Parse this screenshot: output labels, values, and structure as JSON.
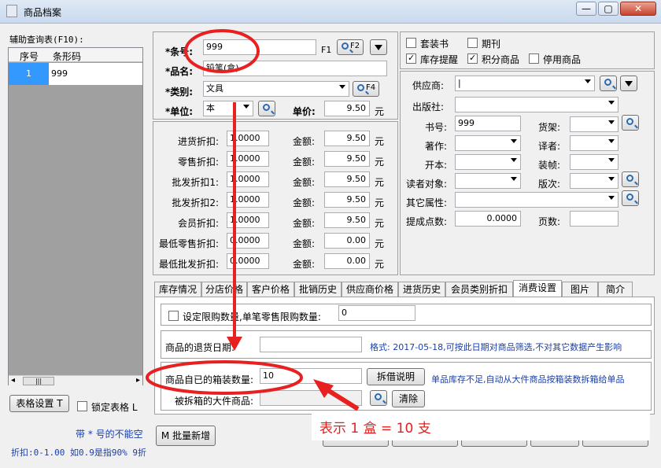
{
  "window": {
    "title": "商品档案",
    "minimize": "—",
    "maximize": "▢",
    "close": "✕"
  },
  "side": {
    "label": "辅助查询表(F10):",
    "columns": [
      "序号",
      "条形码"
    ],
    "rows": [
      {
        "no": "1",
        "code": "999"
      }
    ],
    "scroll_thumb": "|||",
    "grid_settings_btn": "表格设置 T",
    "lock_grid_label": "锁定表格 L",
    "required_note": "带 * 号的不能空",
    "discount_note": "折扣:0-1.00 如0.9是指90%  9折",
    "batch_add_btn": "M 批量新增"
  },
  "basic": {
    "barcode_label": "*条号:",
    "barcode_value": "999",
    "f1": "F1",
    "f2_btn": "F2",
    "name_label": "*品名:",
    "name_value": "铅笔(盒)",
    "category_label": "*类别:",
    "category_value": "文具",
    "f4_btn": "F4",
    "unit_label": "*单位:",
    "unit_value": "本",
    "price_label": "单价:",
    "price_value": "9.50",
    "currency": "元"
  },
  "discounts": [
    {
      "label": "进货折扣:",
      "rate": "1.0000",
      "amt_label": "金额:",
      "amount": "9.50",
      "cur": "元"
    },
    {
      "label": "零售折扣:",
      "rate": "1.0000",
      "amt_label": "金额:",
      "amount": "9.50",
      "cur": "元"
    },
    {
      "label": "批发折扣1:",
      "rate": "1.0000",
      "amt_label": "金额:",
      "amount": "9.50",
      "cur": "元"
    },
    {
      "label": "批发折扣2:",
      "rate": "1.0000",
      "amt_label": "金额:",
      "amount": "9.50",
      "cur": "元"
    },
    {
      "label": "会员折扣:",
      "rate": "1.0000",
      "amt_label": "金额:",
      "amount": "9.50",
      "cur": "元"
    },
    {
      "label": "最低零售折扣:",
      "rate": "0.0000",
      "amt_label": "金额:",
      "amount": "0.00",
      "cur": "元"
    },
    {
      "label": "最低批发折扣:",
      "rate": "0.0000",
      "amt_label": "金额:",
      "amount": "0.00",
      "cur": "元"
    }
  ],
  "flags": {
    "set_book": "套装书",
    "periodical": "期刊",
    "stock_alert": "库存提醒",
    "points_item": "积分商品",
    "disabled_item": "停用商品"
  },
  "extra": {
    "supplier": "供应商:",
    "supplier_value": "|",
    "publisher": "出版社:",
    "book_no": "书号:",
    "book_no_value": "999",
    "shelf": "货架:",
    "author": "著作:",
    "translator": "译者:",
    "format": "开本:",
    "binding": "装帧:",
    "reader": "读者对象:",
    "edition": "版次:",
    "other_attr": "其它属性:",
    "commission": "提成点数:",
    "commission_value": "0.0000",
    "pages": "页数:"
  },
  "tabs": [
    "库存情况",
    "分店价格",
    "客户价格",
    "批销历史",
    "供应商价格",
    "进货历史",
    "会员类别折扣",
    "消费设置",
    "图片",
    "简介"
  ],
  "consume": {
    "limit_label": "设定限购数量,单笔零售限购数量:",
    "limit_value": "0",
    "return_date_label": "商品的退货日期:",
    "return_date_hint": "格式: 2017-05-18,可按此日期对商品筛选,不对其它数据产生影响",
    "box_qty_label": "商品自已的箱装数量:",
    "box_qty_value": "10",
    "split_help_btn": "拆借说明",
    "split_hint": "单品库存不足,自动从大件商品按箱装数拆箱给单品",
    "split_big_label": "被拆箱的大件商品:",
    "clear_btn": "清除"
  },
  "annotation": {
    "text": "表示 1 盒 = 10 支",
    "color": "#e02020"
  }
}
